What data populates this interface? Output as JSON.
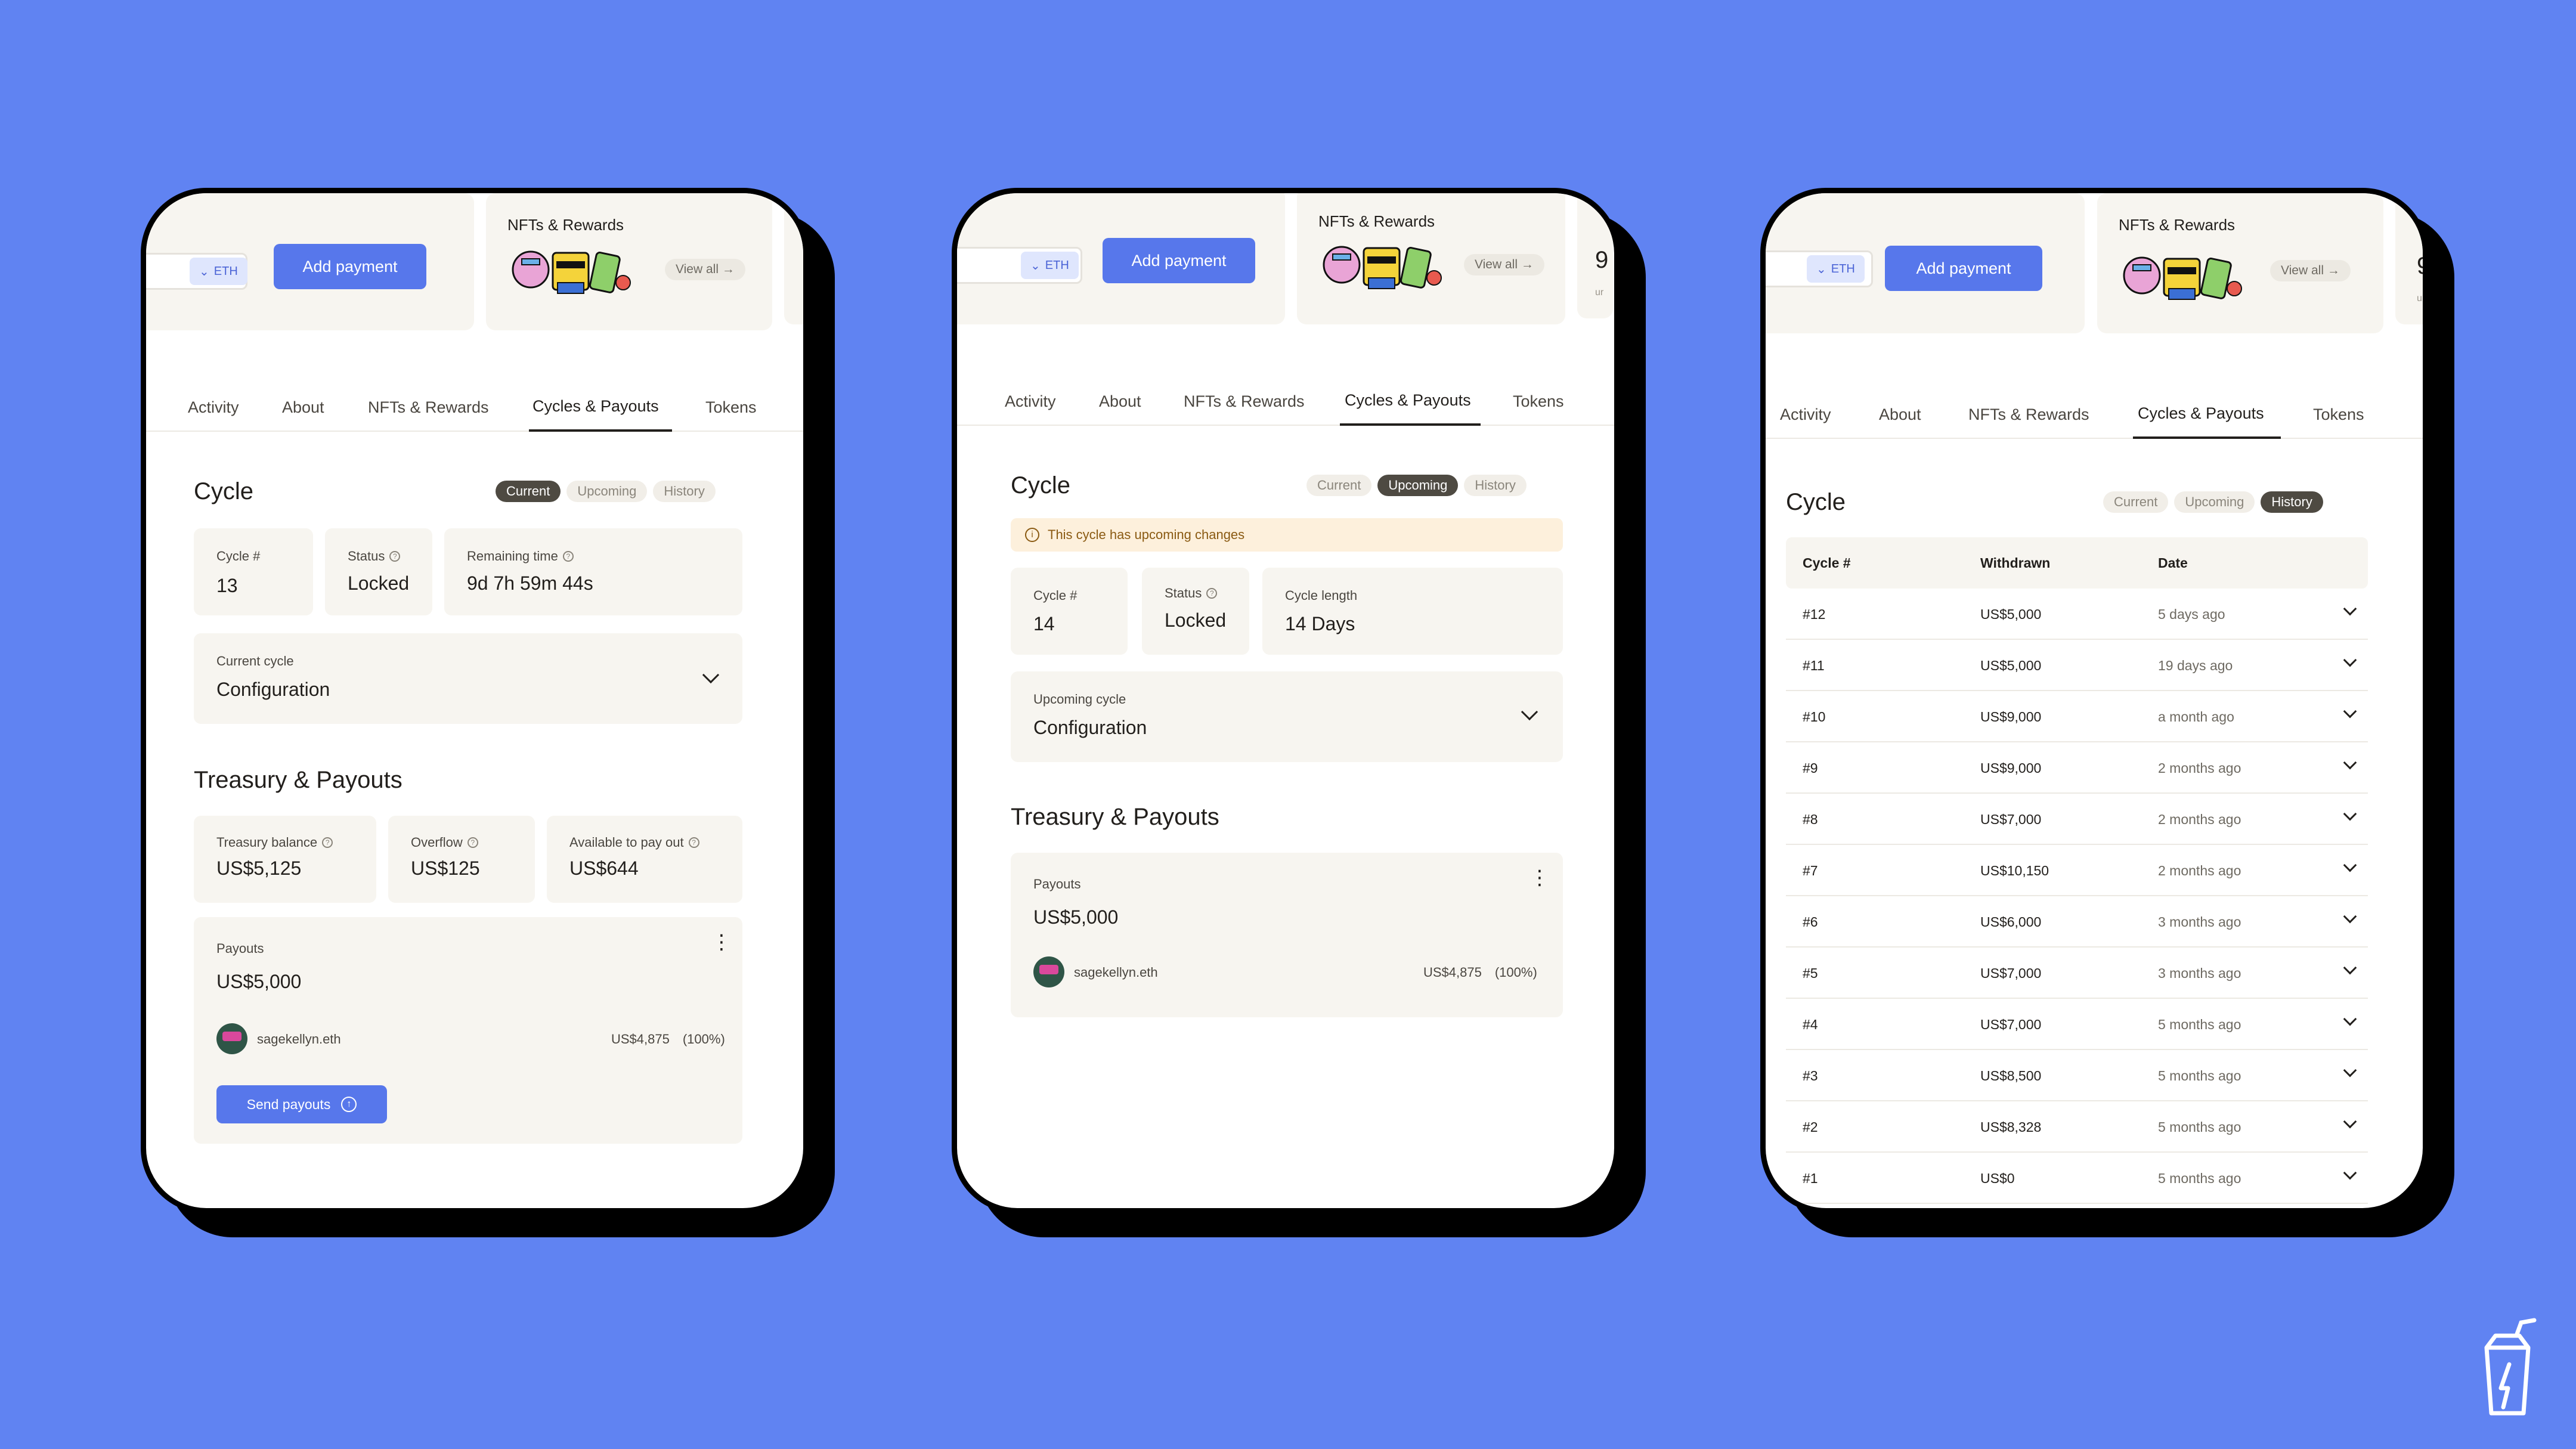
{
  "colors": {
    "background": "#6083F2",
    "accent": "#5777EB",
    "selected_pill": "#4E4A42",
    "warning_bg": "#FDF0DC"
  },
  "common": {
    "currency_chip": "ETH",
    "add_payment": "Add payment",
    "nft_title": "NFTs & Rewards",
    "view_all": "View all →",
    "frag_digit": "9",
    "frag_small": "ur",
    "tabs": [
      "Activity",
      "About",
      "NFTs & Rewards",
      "Cycles & Payouts",
      "Tokens"
    ],
    "cycle_title": "Cycle",
    "pills": [
      "Current",
      "Upcoming",
      "History"
    ],
    "treasury_title": "Treasury & Payouts",
    "payouts_label": "Payouts",
    "payee_name": "sagekellyn.eth",
    "payee_amount": "US$4,875",
    "payee_pct": "(100%)"
  },
  "screen1": {
    "stats": [
      {
        "label": "Cycle #",
        "value": "13"
      },
      {
        "label": "Status",
        "value": "Locked"
      },
      {
        "label": "Remaining time",
        "value": "9d 7h 59m 44s"
      }
    ],
    "config_label": "Current cycle",
    "config_value": "Configuration",
    "treasury_stats": [
      {
        "label": "Treasury balance",
        "value": "US$5,125"
      },
      {
        "label": "Overflow",
        "value": "US$125"
      },
      {
        "label": "Available to pay out",
        "value": "US$644"
      }
    ],
    "payouts_total": "US$5,000",
    "send_payouts": "Send payouts"
  },
  "screen2": {
    "warning": "This cycle has upcoming changes",
    "stats": [
      {
        "label": "Cycle #",
        "value": "14"
      },
      {
        "label": "Status",
        "value": "Locked"
      },
      {
        "label": "Cycle length",
        "value": "14 Days"
      }
    ],
    "config_label": "Upcoming cycle",
    "config_value": "Configuration",
    "payouts_total": "US$5,000"
  },
  "screen3": {
    "columns": [
      "Cycle #",
      "Withdrawn",
      "Date"
    ],
    "rows": [
      {
        "cycle": "#12",
        "withdrawn": "US$5,000",
        "date": "5 days ago"
      },
      {
        "cycle": "#11",
        "withdrawn": "US$5,000",
        "date": "19 days ago"
      },
      {
        "cycle": "#10",
        "withdrawn": "US$9,000",
        "date": "a month ago"
      },
      {
        "cycle": "#9",
        "withdrawn": "US$9,000",
        "date": "2 months ago"
      },
      {
        "cycle": "#8",
        "withdrawn": "US$7,000",
        "date": "2 months ago"
      },
      {
        "cycle": "#7",
        "withdrawn": "US$10,150",
        "date": "2 months ago"
      },
      {
        "cycle": "#6",
        "withdrawn": "US$6,000",
        "date": "3 months ago"
      },
      {
        "cycle": "#5",
        "withdrawn": "US$7,000",
        "date": "3 months ago"
      },
      {
        "cycle": "#4",
        "withdrawn": "US$7,000",
        "date": "5 months ago"
      },
      {
        "cycle": "#3",
        "withdrawn": "US$8,500",
        "date": "5 months ago"
      },
      {
        "cycle": "#2",
        "withdrawn": "US$8,328",
        "date": "5 months ago"
      },
      {
        "cycle": "#1",
        "withdrawn": "US$0",
        "date": "5 months ago"
      }
    ]
  }
}
